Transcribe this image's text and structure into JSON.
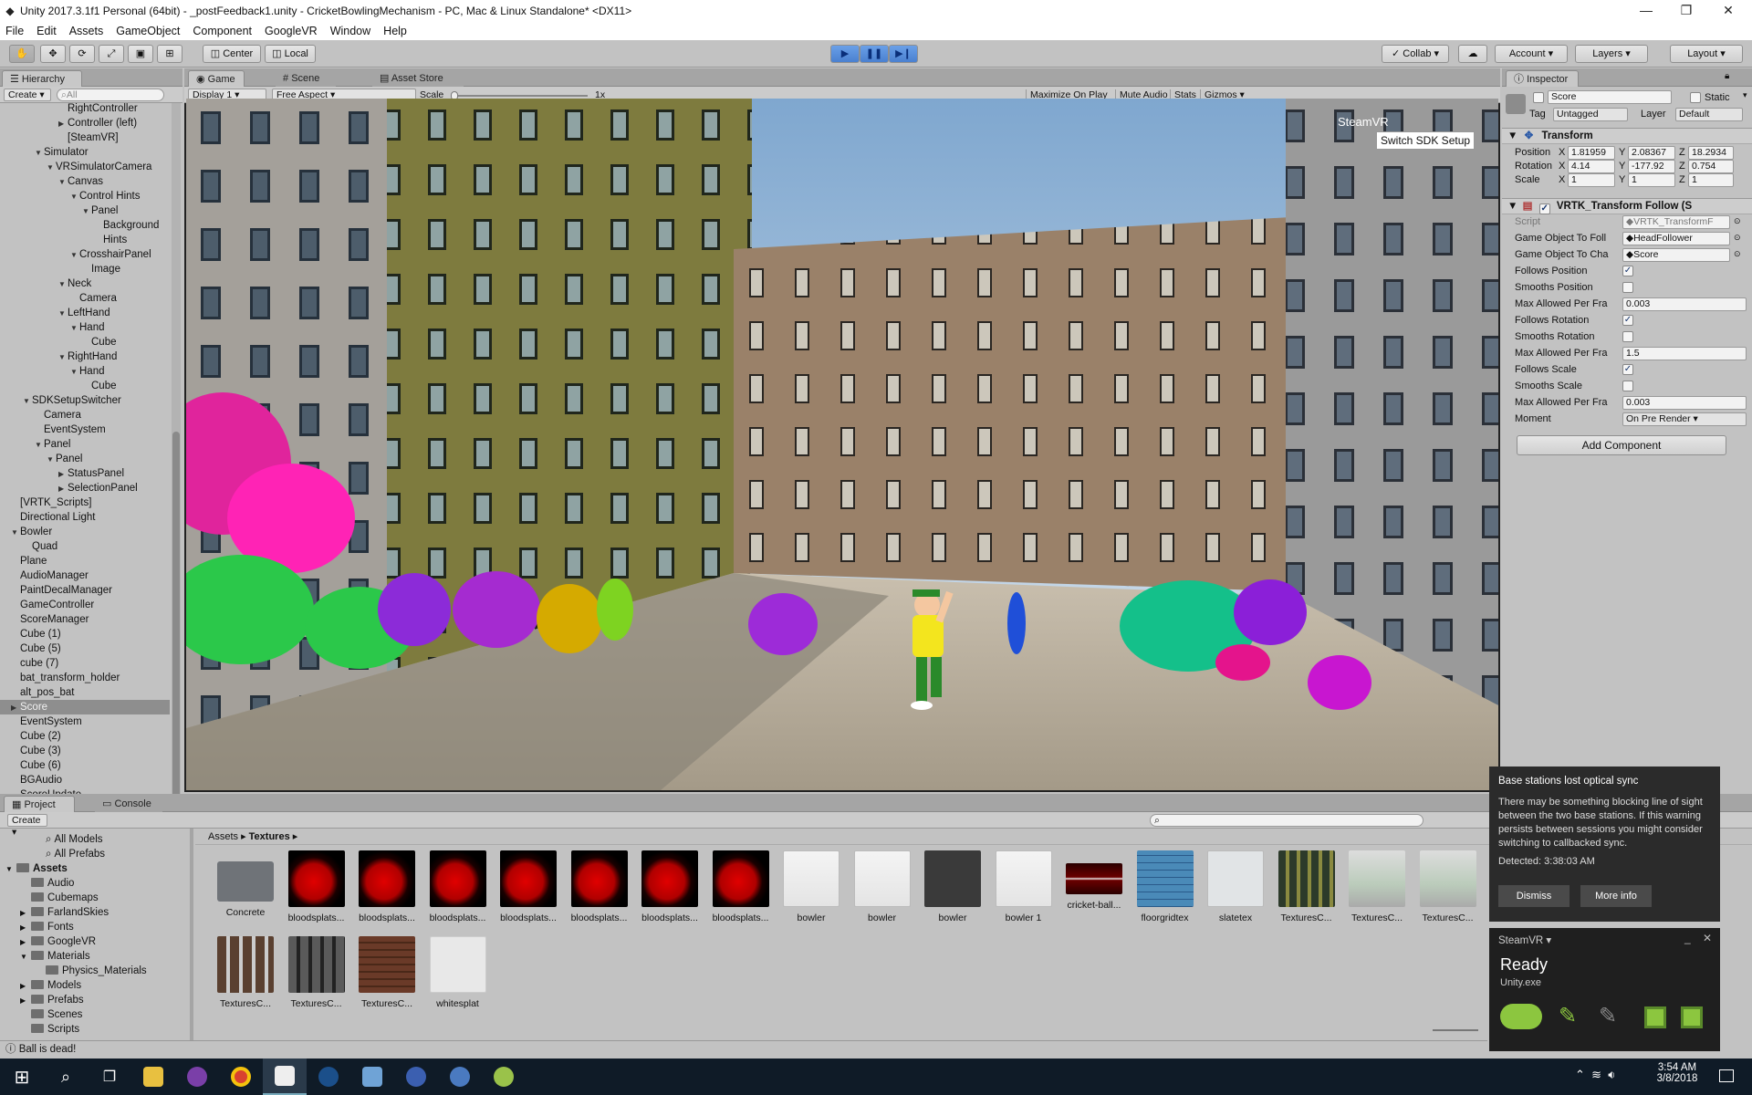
{
  "window": {
    "title": "Unity 2017.3.1f1 Personal (64bit) - _postFeedback1.unity - CricketBowlingMechanism - PC, Mac & Linux Standalone* <DX11>",
    "controls": [
      "—",
      "❐",
      "✕"
    ]
  },
  "menu": [
    "File",
    "Edit",
    "Assets",
    "GameObject",
    "Component",
    "GoogleVR",
    "Window",
    "Help"
  ],
  "toolbar": {
    "pivot": "Center",
    "space": "Local",
    "collab": "Collab",
    "account": "Account",
    "layers": "Layers",
    "layout": "Layout"
  },
  "hierarchy": {
    "tab": "Hierarchy",
    "create": "Create",
    "search_placeholder": "All",
    "items": [
      {
        "label": "RightController",
        "indent": 4,
        "arrow": ""
      },
      {
        "label": "Controller (left)",
        "indent": 4,
        "arrow": "▶"
      },
      {
        "label": "[SteamVR]",
        "indent": 4,
        "arrow": ""
      },
      {
        "label": "Simulator",
        "indent": 2,
        "arrow": "▼"
      },
      {
        "label": "VRSimulatorCamera",
        "indent": 3,
        "arrow": "▼"
      },
      {
        "label": "Canvas",
        "indent": 4,
        "arrow": "▼"
      },
      {
        "label": "Control Hints",
        "indent": 5,
        "arrow": "▼"
      },
      {
        "label": "Panel",
        "indent": 6,
        "arrow": "▼"
      },
      {
        "label": "Background",
        "indent": 7,
        "arrow": ""
      },
      {
        "label": "Hints",
        "indent": 7,
        "arrow": ""
      },
      {
        "label": "CrosshairPanel",
        "indent": 5,
        "arrow": "▼"
      },
      {
        "label": "Image",
        "indent": 6,
        "arrow": ""
      },
      {
        "label": "Neck",
        "indent": 4,
        "arrow": "▼"
      },
      {
        "label": "Camera",
        "indent": 5,
        "arrow": ""
      },
      {
        "label": "LeftHand",
        "indent": 4,
        "arrow": "▼"
      },
      {
        "label": "Hand",
        "indent": 5,
        "arrow": "▼"
      },
      {
        "label": "Cube",
        "indent": 6,
        "arrow": ""
      },
      {
        "label": "RightHand",
        "indent": 4,
        "arrow": "▼"
      },
      {
        "label": "Hand",
        "indent": 5,
        "arrow": "▼"
      },
      {
        "label": "Cube",
        "indent": 6,
        "arrow": ""
      },
      {
        "label": "SDKSetupSwitcher",
        "indent": 1,
        "arrow": "▼"
      },
      {
        "label": "Camera",
        "indent": 2,
        "arrow": ""
      },
      {
        "label": "EventSystem",
        "indent": 2,
        "arrow": ""
      },
      {
        "label": "Panel",
        "indent": 2,
        "arrow": "▼"
      },
      {
        "label": "Panel",
        "indent": 3,
        "arrow": "▼"
      },
      {
        "label": "StatusPanel",
        "indent": 4,
        "arrow": "▶"
      },
      {
        "label": "SelectionPanel",
        "indent": 4,
        "arrow": "▶"
      },
      {
        "label": "[VRTK_Scripts]",
        "indent": 0,
        "arrow": ""
      },
      {
        "label": "Directional Light",
        "indent": 0,
        "arrow": ""
      },
      {
        "label": "Bowler",
        "indent": 0,
        "arrow": "▼"
      },
      {
        "label": "Quad",
        "indent": 1,
        "arrow": ""
      },
      {
        "label": "Plane",
        "indent": 0,
        "arrow": ""
      },
      {
        "label": "AudioManager",
        "indent": 0,
        "arrow": ""
      },
      {
        "label": "PaintDecalManager",
        "indent": 0,
        "arrow": ""
      },
      {
        "label": "GameController",
        "indent": 0,
        "arrow": ""
      },
      {
        "label": "ScoreManager",
        "indent": 0,
        "arrow": ""
      },
      {
        "label": "Cube (1)",
        "indent": 0,
        "arrow": ""
      },
      {
        "label": "Cube (5)",
        "indent": 0,
        "arrow": ""
      },
      {
        "label": "cube (7)",
        "indent": 0,
        "arrow": ""
      },
      {
        "label": "bat_transform_holder",
        "indent": 0,
        "arrow": ""
      },
      {
        "label": "alt_pos_bat",
        "indent": 0,
        "arrow": ""
      },
      {
        "label": "Score",
        "indent": 0,
        "arrow": "▶",
        "selected": true
      },
      {
        "label": "EventSystem",
        "indent": 0,
        "arrow": ""
      },
      {
        "label": "Cube (2)",
        "indent": 0,
        "arrow": ""
      },
      {
        "label": "Cube (3)",
        "indent": 0,
        "arrow": ""
      },
      {
        "label": "Cube (6)",
        "indent": 0,
        "arrow": ""
      },
      {
        "label": "BGAudio",
        "indent": 0,
        "arrow": ""
      },
      {
        "label": "ScoreUpdate",
        "indent": 0,
        "arrow": ""
      }
    ]
  },
  "game": {
    "tabs": [
      "Game",
      "Scene",
      "Asset Store"
    ],
    "display": "Display 1",
    "aspect": "Free Aspect",
    "scale_label": "Scale",
    "scale_value": "1x",
    "scale_fraction": 0.0,
    "right_buttons": [
      "Maximize On Play",
      "Mute Audio",
      "Stats",
      "Gizmos"
    ],
    "overlay_title": "SteamVR",
    "overlay_button": "Switch SDK Setup"
  },
  "inspector": {
    "tab": "Inspector",
    "object_name": "Score",
    "static_label": "Static",
    "tag_label": "Tag",
    "tag_value": "Untagged",
    "layer_label": "Layer",
    "layer_value": "Default",
    "transform": {
      "title": "Transform",
      "rows": [
        {
          "label": "Position",
          "x": "1.81959",
          "y": "2.08367",
          "z": "18.2934"
        },
        {
          "label": "Rotation",
          "x": "4.14",
          "y": "-177.92",
          "z": "0.754"
        },
        {
          "label": "Scale",
          "x": "1",
          "y": "1",
          "z": "1"
        }
      ]
    },
    "component": {
      "title": "VRTK_Transform Follow (S",
      "rows": [
        {
          "label": "Script",
          "kind": "ref",
          "value": "VRTK_TransformF",
          "dim": true
        },
        {
          "label": "Game Object To Foll",
          "kind": "ref",
          "value": "HeadFollower"
        },
        {
          "label": "Game Object To Cha",
          "kind": "ref",
          "value": "Score"
        },
        {
          "label": "Follows Position",
          "kind": "check",
          "checked": true
        },
        {
          "label": "Smooths Position",
          "kind": "check",
          "checked": false
        },
        {
          "label": "Max Allowed Per Fra",
          "kind": "text",
          "value": "0.003"
        },
        {
          "label": "Follows Rotation",
          "kind": "check",
          "checked": true
        },
        {
          "label": "Smooths Rotation",
          "kind": "check",
          "checked": false
        },
        {
          "label": "Max Allowed Per Fra",
          "kind": "text",
          "value": "1.5"
        },
        {
          "label": "Follows Scale",
          "kind": "check",
          "checked": true
        },
        {
          "label": "Smooths Scale",
          "kind": "check",
          "checked": false
        },
        {
          "label": "Max Allowed Per Fra",
          "kind": "text",
          "value": "0.003"
        },
        {
          "label": "Moment",
          "kind": "drop",
          "value": "On Pre Render"
        }
      ]
    },
    "add_component": "Add Component"
  },
  "project": {
    "tabs": [
      "Project",
      "Console"
    ],
    "create": "Create",
    "breadcrumb": [
      "Assets",
      "Textures"
    ],
    "tree": [
      {
        "label": "All Models",
        "indent": 2,
        "arrow": "",
        "kind": "search"
      },
      {
        "label": "All Prefabs",
        "indent": 2,
        "arrow": "",
        "kind": "search"
      },
      {
        "label": "Assets",
        "indent": 0,
        "arrow": "▼",
        "kind": "folder",
        "bold": true
      },
      {
        "label": "Audio",
        "indent": 1,
        "arrow": "",
        "kind": "folder"
      },
      {
        "label": "Cubemaps",
        "indent": 1,
        "arrow": "",
        "kind": "folder"
      },
      {
        "label": "FarlandSkies",
        "indent": 1,
        "arrow": "▶",
        "kind": "folder"
      },
      {
        "label": "Fonts",
        "indent": 1,
        "arrow": "▶",
        "kind": "folder"
      },
      {
        "label": "GoogleVR",
        "indent": 1,
        "arrow": "▶",
        "kind": "folder"
      },
      {
        "label": "Materials",
        "indent": 1,
        "arrow": "▼",
        "kind": "folder"
      },
      {
        "label": "Physics_Materials",
        "indent": 2,
        "arrow": "",
        "kind": "folder"
      },
      {
        "label": "Models",
        "indent": 1,
        "arrow": "▶",
        "kind": "folder"
      },
      {
        "label": "Prefabs",
        "indent": 1,
        "arrow": "▶",
        "kind": "folder"
      },
      {
        "label": "Scenes",
        "indent": 1,
        "arrow": "",
        "kind": "folder"
      },
      {
        "label": "Scripts",
        "indent": 1,
        "arrow": "",
        "kind": "folder"
      }
    ],
    "assets": [
      {
        "label": "Concrete",
        "kind": "folder"
      },
      {
        "label": "bloodsplats...",
        "kind": "splat",
        "color": "#d40000"
      },
      {
        "label": "bloodsplats...",
        "kind": "splat",
        "color": "#d40000"
      },
      {
        "label": "bloodsplats...",
        "kind": "splat",
        "color": "#d40000"
      },
      {
        "label": "bloodsplats...",
        "kind": "splat",
        "color": "#d40000"
      },
      {
        "label": "bloodsplats...",
        "kind": "splat",
        "color": "#d40000"
      },
      {
        "label": "bloodsplats...",
        "kind": "splat",
        "color": "#d40000"
      },
      {
        "label": "bloodsplats...",
        "kind": "splat",
        "color": "#d40000"
      },
      {
        "label": "bowler",
        "kind": "bowler"
      },
      {
        "label": "bowler",
        "kind": "bowler"
      },
      {
        "label": "bowler",
        "kind": "bowler-dark"
      },
      {
        "label": "bowler 1",
        "kind": "bowler"
      },
      {
        "label": "cricket-ball...",
        "kind": "ball"
      },
      {
        "label": "floorgridtex",
        "kind": "grid"
      },
      {
        "label": "slatetex",
        "kind": "slate"
      },
      {
        "label": "TexturesC...",
        "kind": "building-dark"
      },
      {
        "label": "TexturesC...",
        "kind": "building-light"
      },
      {
        "label": "TexturesC...",
        "kind": "building-light"
      },
      {
        "label": "TexturesC...",
        "kind": "building-brown"
      },
      {
        "label": "TexturesC...",
        "kind": "building-grey"
      },
      {
        "label": "TexturesC...",
        "kind": "building-brick"
      },
      {
        "label": "whitesplat",
        "kind": "white"
      }
    ]
  },
  "status_bar": "Ball is dead!",
  "notification": {
    "title": "Base stations lost optical sync",
    "body": "There may be something blocking line of sight between the two base stations. If this warning persists between sessions you might consider switching to callbacked sync.",
    "detected": "Detected: 3:38:03 AM",
    "dismiss": "Dismiss",
    "more_info": "More info"
  },
  "steamvr": {
    "title": "SteamVR",
    "status": "Ready",
    "app": "Unity.exe",
    "accent": "#8cc63f"
  },
  "taskbar": {
    "time": "3:54 AM",
    "date": "3/8/2018"
  }
}
